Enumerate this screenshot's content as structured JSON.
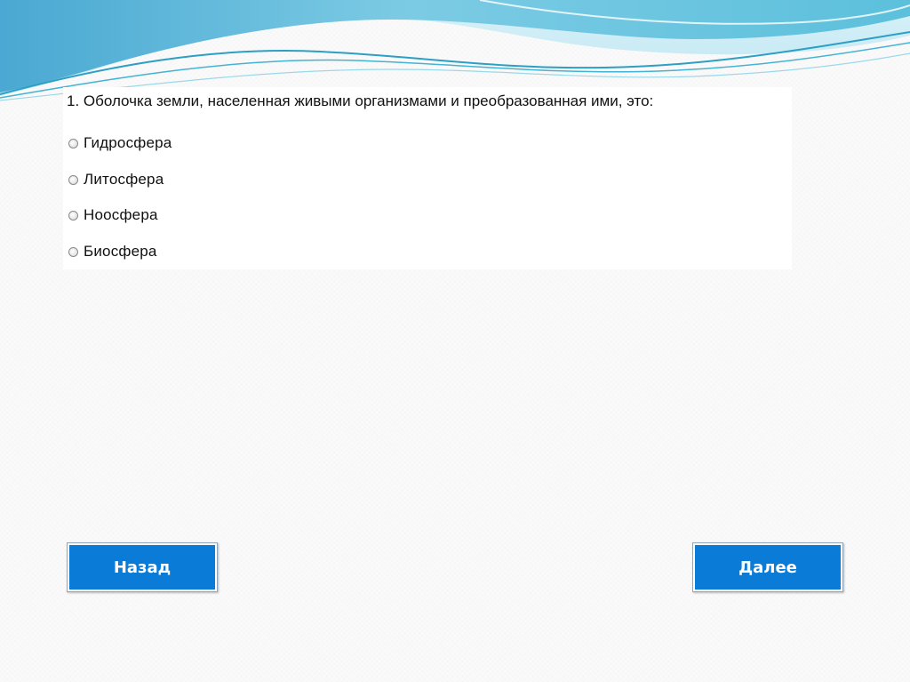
{
  "quiz": {
    "question": "1. Оболочка земли, населенная живыми организмами и преобразованная ими, это:",
    "options": [
      {
        "label": "Гидросфера",
        "selected": false
      },
      {
        "label": "Литосфера",
        "selected": false
      },
      {
        "label": "Ноосфера",
        "selected": false
      },
      {
        "label": "Биосфера",
        "selected": false
      }
    ]
  },
  "navigation": {
    "back_label": "Назад",
    "next_label": "Далее"
  },
  "colors": {
    "button_blue": "#0a7bd6",
    "wave_light": "#bfe6f2",
    "wave_mid": "#5cc0dc",
    "wave_dark": "#2d9fc4",
    "background": "#fafafa"
  }
}
